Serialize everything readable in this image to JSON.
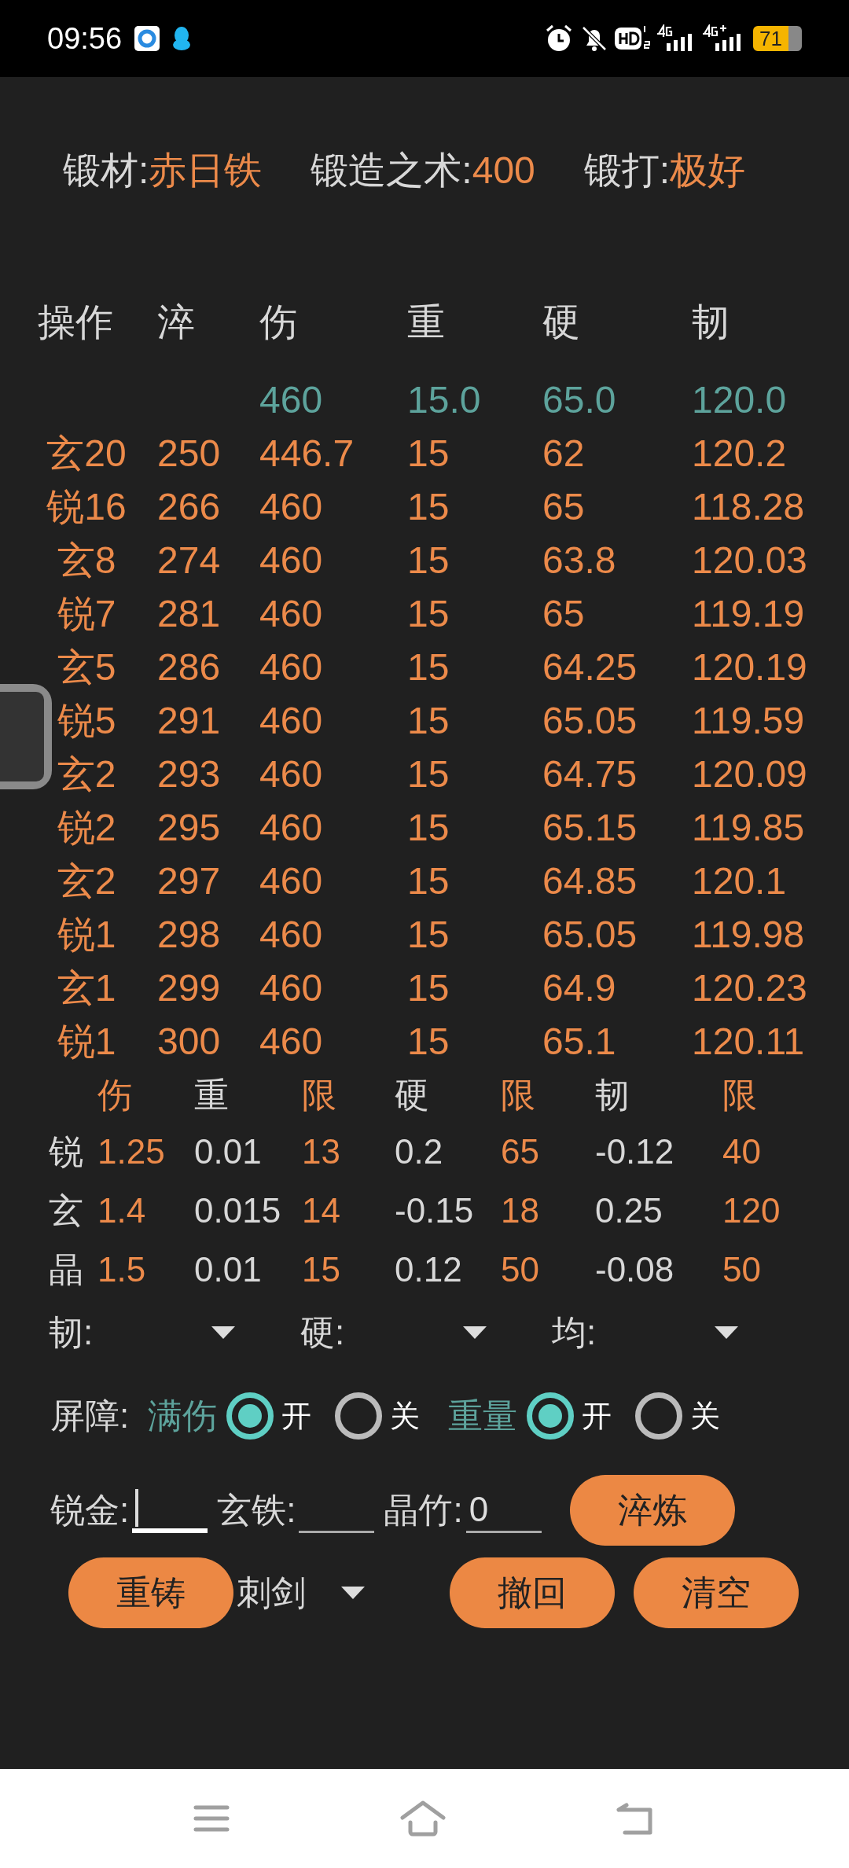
{
  "status_bar": {
    "time": "09:56",
    "battery": "71"
  },
  "info": [
    {
      "label": "锻材:",
      "value": "赤日铁"
    },
    {
      "label": "锻造之术:",
      "value": "400"
    },
    {
      "label": "锻打:",
      "value": "极好"
    }
  ],
  "table": {
    "columns": [
      "操作",
      "淬",
      "伤",
      "重",
      "硬",
      "韧"
    ],
    "target_row": [
      "460",
      "15.0",
      "65.0",
      "120.0"
    ],
    "rows": [
      [
        "玄20",
        "250",
        "446.7",
        "15",
        "62",
        "120.2"
      ],
      [
        "锐16",
        "266",
        "460",
        "15",
        "65",
        "118.28"
      ],
      [
        "玄8",
        "274",
        "460",
        "15",
        "63.8",
        "120.03"
      ],
      [
        "锐7",
        "281",
        "460",
        "15",
        "65",
        "119.19"
      ],
      [
        "玄5",
        "286",
        "460",
        "15",
        "64.25",
        "120.19"
      ],
      [
        "锐5",
        "291",
        "460",
        "15",
        "65.05",
        "119.59"
      ],
      [
        "玄2",
        "293",
        "460",
        "15",
        "64.75",
        "120.09"
      ],
      [
        "锐2",
        "295",
        "460",
        "15",
        "65.15",
        "119.85"
      ],
      [
        "玄2",
        "297",
        "460",
        "15",
        "64.85",
        "120.1"
      ],
      [
        "锐1",
        "298",
        "460",
        "15",
        "65.05",
        "119.98"
      ],
      [
        "玄1",
        "299",
        "460",
        "15",
        "64.9",
        "120.23"
      ],
      [
        "锐1",
        "300",
        "460",
        "15",
        "65.1",
        "120.11"
      ]
    ]
  },
  "params": {
    "columns": [
      {
        "label": "伤",
        "highlight": true
      },
      {
        "label": "重",
        "highlight": false
      },
      {
        "label": "限",
        "highlight": true
      },
      {
        "label": "硬",
        "highlight": false
      },
      {
        "label": "限",
        "highlight": true
      },
      {
        "label": "韧",
        "highlight": false
      },
      {
        "label": "限",
        "highlight": true
      }
    ],
    "rows": [
      {
        "label": "锐",
        "values": [
          "1.25",
          "0.01",
          "13",
          "0.2",
          "65",
          "-0.12",
          "40"
        ]
      },
      {
        "label": "玄",
        "values": [
          "1.4",
          "0.015",
          "14",
          "-0.15",
          "18",
          "0.25",
          "120"
        ]
      },
      {
        "label": "晶",
        "values": [
          "1.5",
          "0.01",
          "15",
          "0.12",
          "50",
          "-0.08",
          "50"
        ]
      }
    ]
  },
  "dropdowns": [
    {
      "label": "韧:"
    },
    {
      "label": "硬:"
    },
    {
      "label": "均:"
    }
  ],
  "barrier": {
    "label": "屏障:",
    "groups": [
      {
        "label": "满伤",
        "options": [
          {
            "label": "开",
            "selected": true
          },
          {
            "label": "关",
            "selected": false
          }
        ]
      },
      {
        "label": "重量",
        "options": [
          {
            "label": "开",
            "selected": true
          },
          {
            "label": "关",
            "selected": false
          }
        ]
      }
    ]
  },
  "inputs": [
    {
      "label": "锐金:",
      "focused": true
    },
    {
      "label": "玄铁:",
      "focused": false
    },
    {
      "label": "晶竹:",
      "value": "0",
      "focused": false
    }
  ],
  "quench_button": "淬炼",
  "recast_button": "重铸",
  "weapon_select": "刺剑",
  "undo_button": "撤回",
  "clear_button": "清空"
}
